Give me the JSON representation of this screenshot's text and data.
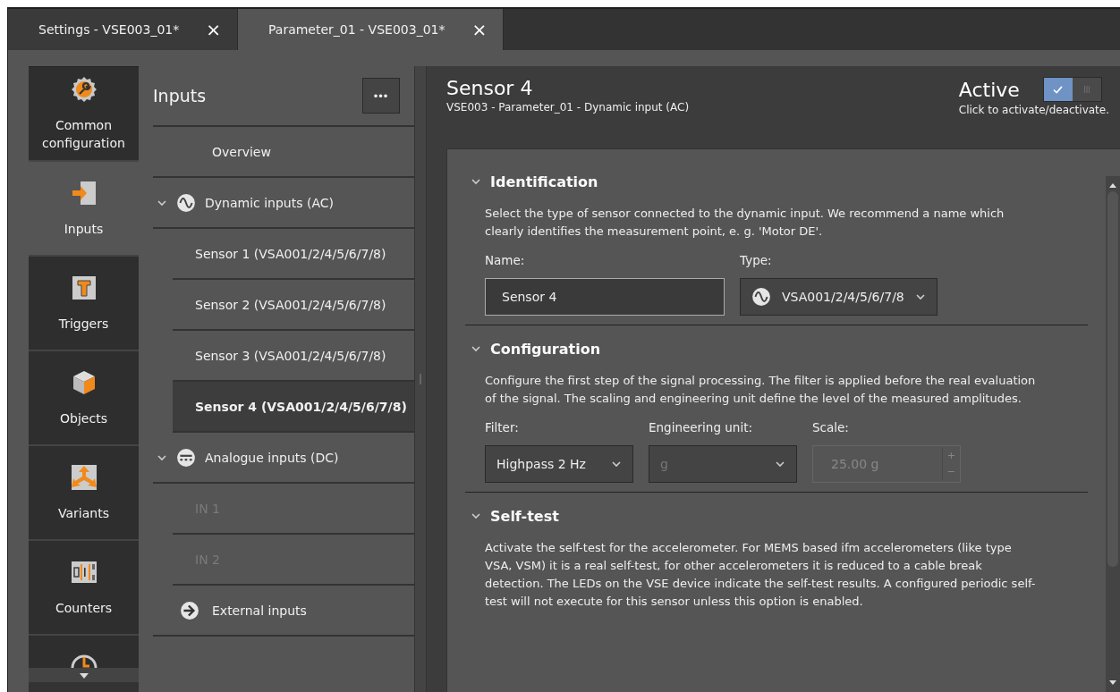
{
  "tabs": [
    {
      "label": "Settings - VSE003_01*",
      "close": "×",
      "selected": false
    },
    {
      "label": "Parameter_01 - VSE003_01*",
      "close": "×",
      "selected": true
    }
  ],
  "nav": [
    {
      "kind": "gear",
      "label": "Common configuration",
      "selected": false
    },
    {
      "kind": "input",
      "label": "Inputs",
      "selected": true
    },
    {
      "kind": "trigger",
      "label": "Triggers",
      "selected": false
    },
    {
      "kind": "cube",
      "label": "Objects",
      "selected": false
    },
    {
      "kind": "variants",
      "label": "Variants",
      "selected": false
    },
    {
      "kind": "counter",
      "label": "Counters",
      "selected": false
    },
    {
      "kind": "clock",
      "selected": false
    }
  ],
  "list": {
    "title": "Inputs",
    "menu": "•••",
    "items": [
      {
        "kind": "plain",
        "label": "Overview",
        "selected": false,
        "disabled": false
      },
      {
        "kind": "group",
        "label": "Dynamic inputs (AC)",
        "expanded": true,
        "children": [
          {
            "label": "Sensor 1 (VSA001/2/4/5/6/7/8)",
            "selected": false,
            "disabled": false
          },
          {
            "label": "Sensor 2 (VSA001/2/4/5/6/7/8)",
            "selected": false,
            "disabled": false
          },
          {
            "label": "Sensor 3 (VSA001/2/4/5/6/7/8)",
            "selected": false,
            "disabled": false
          },
          {
            "label": "Sensor 4 (VSA001/2/4/5/6/7/8)",
            "selected": true,
            "disabled": false
          }
        ]
      },
      {
        "kind": "group",
        "label": "Analogue inputs (DC)",
        "expanded": true,
        "children": [
          {
            "label": "IN 1",
            "selected": false,
            "disabled": true
          },
          {
            "label": "IN 2",
            "selected": false,
            "disabled": true
          }
        ]
      },
      {
        "kind": "link",
        "label": "External inputs",
        "selected": false,
        "disabled": false
      }
    ]
  },
  "detail": {
    "title": "Sensor 4",
    "subtitle": "VSE003 - Parameter_01 - Dynamic input (AC)",
    "active_label": "Active",
    "active": true,
    "active_hint": "Click to activate/deactivate.",
    "sections": [
      {
        "title": "Identification",
        "expanded": true,
        "text": "Select the type of sensor connected to the dynamic input. We recommend a name which clearly identifies the measurement point, e. g. 'Motor DE'.",
        "fields": [
          {
            "kind": "text",
            "label": "Name:",
            "value": "Sensor 4",
            "disabled": false
          },
          {
            "kind": "icon_select",
            "label": "Type:",
            "value": "VSA001/2/4/5/6/7/8",
            "disabled": false
          }
        ]
      },
      {
        "title": "Configuration",
        "expanded": true,
        "text": "Configure the first step of the signal processing. The filter is applied before the real evaluation of the signal. The scaling and engineering unit define the level of the measured amplitudes.",
        "fields": [
          {
            "kind": "select",
            "label": "Filter:",
            "value": "Highpass 2 Hz",
            "disabled": false
          },
          {
            "kind": "select",
            "label": "Engineering unit:",
            "value": "g",
            "disabled": true
          },
          {
            "kind": "spin",
            "label": "Scale:",
            "value": "25.00 g",
            "up": "+",
            "down": "−",
            "disabled": true
          }
        ]
      },
      {
        "title": "Self-test",
        "expanded": true,
        "text": "Activate the self-test for the accelerometer. For MEMS based ifm accelerometers (like type VSA, VSM) it is a real self-test, for other accelerometers it is reduced to a cable break detection. The LEDs on the VSE device indicate the self-test results. A configured periodic self-test will not execute for this sensor unless this option is enabled."
      }
    ]
  }
}
